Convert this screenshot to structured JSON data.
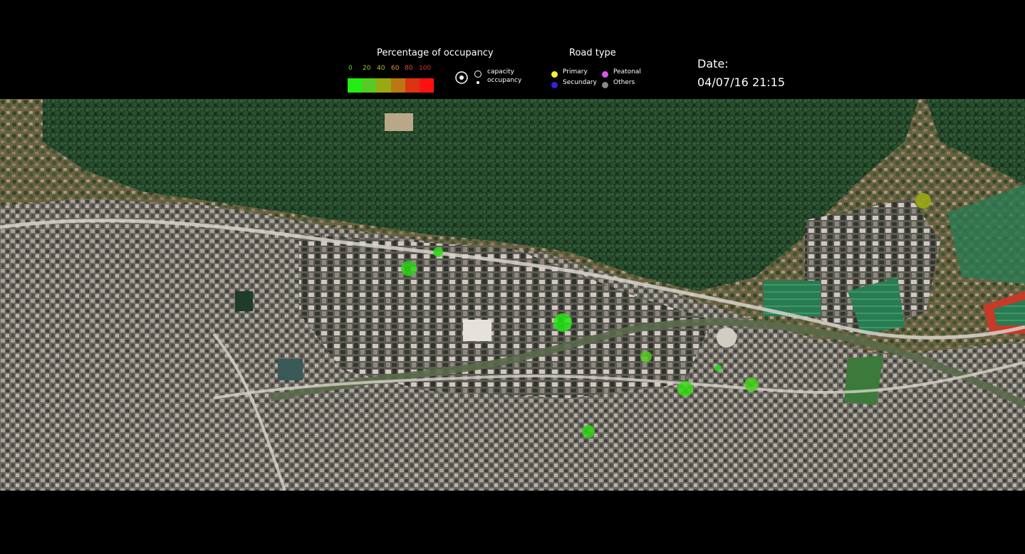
{
  "legend": {
    "occupancy_title": "Percentage of occupancy",
    "ticks": [
      "0",
      "20",
      "40",
      "60",
      "80",
      "100"
    ],
    "tick_colors": [
      "#5cd62a",
      "#8fcf2a",
      "#b3c02a",
      "#d69a2a",
      "#e0502a",
      "#e02a2a"
    ],
    "scale_colors": [
      "#22ee11",
      "#55cc22",
      "#99aa11",
      "#bb7711",
      "#dd3311",
      "#ff1111"
    ],
    "capacity_label": "capacity",
    "occupancy_label": "occupancy",
    "road_type_title": "Road type",
    "road_types": [
      {
        "label": "Primary",
        "color": "#f5f520"
      },
      {
        "label": "Peatonal",
        "color": "#dd55ee"
      },
      {
        "label": "Secundary",
        "color": "#3322dd"
      },
      {
        "label": "Others",
        "color": "#888888"
      }
    ]
  },
  "date": {
    "label": "Date:",
    "value": "04/07/16  21:15"
  },
  "map": {
    "parking_markers": [
      {
        "id": "p1",
        "occupancy_pct": 5
      },
      {
        "id": "p2",
        "occupancy_pct": 8
      },
      {
        "id": "p3",
        "occupancy_pct": 5
      },
      {
        "id": "p4",
        "occupancy_pct": 15
      },
      {
        "id": "p5",
        "occupancy_pct": 3
      },
      {
        "id": "p6",
        "occupancy_pct": 10
      },
      {
        "id": "p7",
        "occupancy_pct": 12
      },
      {
        "id": "p8",
        "occupancy_pct": 6
      },
      {
        "id": "p9",
        "occupancy_pct": 35
      }
    ]
  }
}
